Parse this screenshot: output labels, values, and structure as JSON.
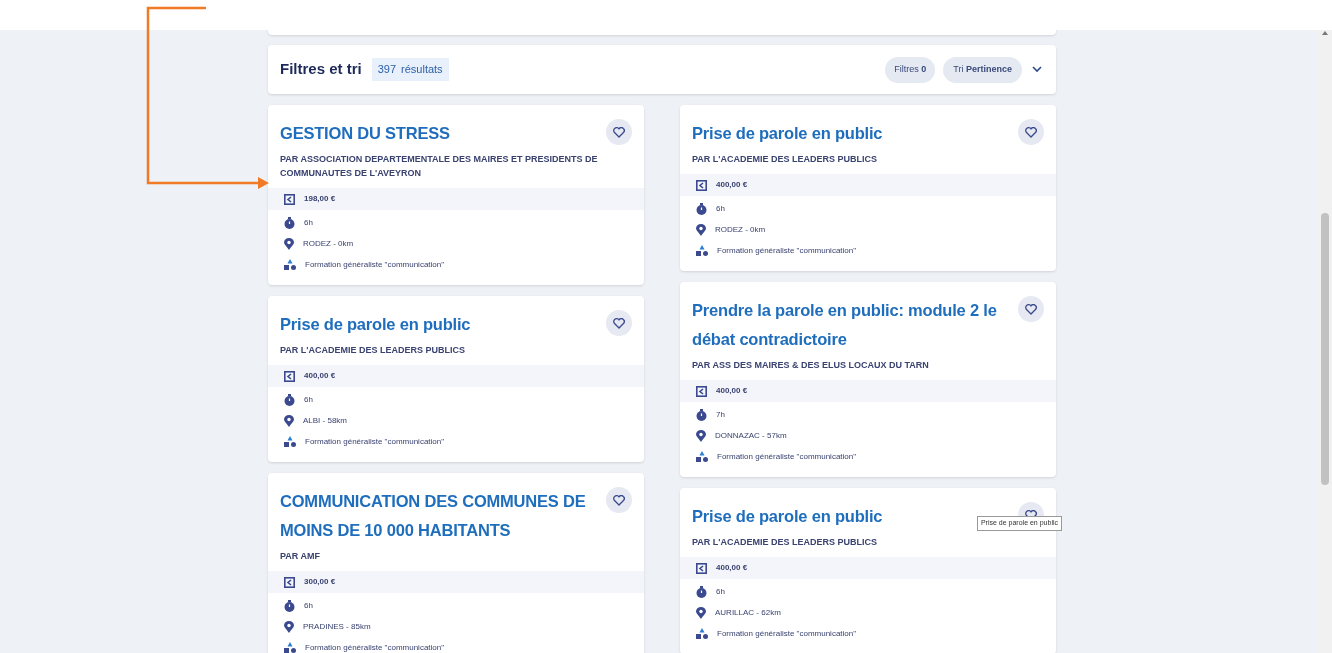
{
  "filter_bar": {
    "title": "Filtres et tri",
    "count": "397",
    "count_label": "résultats",
    "filters_label": "Filtres",
    "filters_count": "0",
    "sort_label": "Tri",
    "sort_value": "Pertinence"
  },
  "columns": [
    {
      "cards": [
        {
          "title": "GESTION DU STRESS",
          "provider": "PAR ASSOCIATION DEPARTEMENTALE DES MAIRES ET PRESIDENTS DE COMMUNAUTES DE L'AVEYRON",
          "price": "198,00 €",
          "duration": "6h",
          "location": "RODEZ - 0km",
          "category": "Formation généraliste \"communication\"",
          "favorite": false
        },
        {
          "title": "Prise de parole en public",
          "provider": "PAR L'ACADEMIE DES LEADERS PUBLICS",
          "price": "400,00 €",
          "duration": "6h",
          "location": "ALBI - 58km",
          "category": "Formation généraliste \"communication\"",
          "favorite": false
        },
        {
          "title": "COMMUNICATION DES COMMUNES DE MOINS DE 10 000 HABITANTS",
          "provider": "PAR AMF",
          "price": "300,00 €",
          "duration": "6h",
          "location": "PRADINES - 85km",
          "category": "Formation généraliste \"communication\"",
          "favorite": false
        }
      ]
    },
    {
      "cards": [
        {
          "title": "Prise de parole en public",
          "provider": "PAR L'ACADEMIE DES LEADERS PUBLICS",
          "price": "400,00 €",
          "duration": "6h",
          "location": "RODEZ - 0km",
          "category": "Formation généraliste \"communication\"",
          "favorite": false
        },
        {
          "title": "Prendre la parole en public: module 2 le débat contradictoire",
          "provider": "PAR ASS DES MAIRES & DES ELUS LOCAUX DU TARN",
          "price": "400,00 €",
          "duration": "7h",
          "location": "DONNAZAC - 57km",
          "category": "Formation généraliste \"communication\"",
          "favorite": false
        },
        {
          "title": "Prise de parole en public",
          "provider": "PAR L'ACADEMIE DES LEADERS PUBLICS",
          "price": "400,00 €",
          "duration": "6h",
          "location": "AURILLAC - 62km",
          "category": "Formation généraliste \"communication\"",
          "favorite": false,
          "tooltip": "Prise de parole en public"
        }
      ]
    }
  ]
}
